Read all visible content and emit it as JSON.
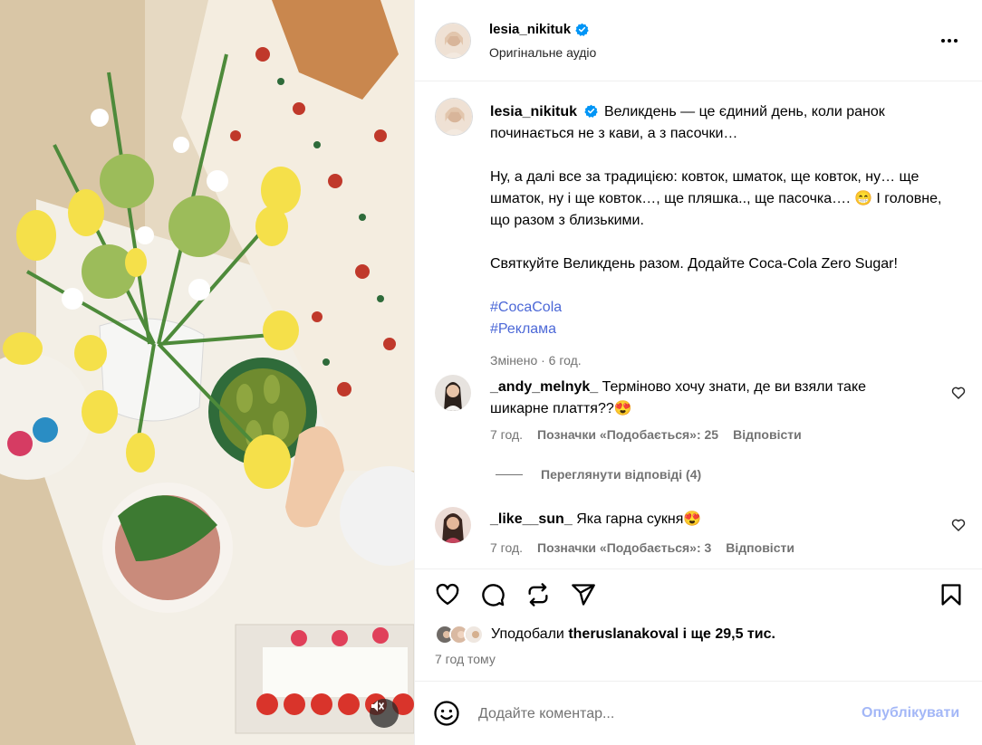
{
  "post": {
    "author": "lesia_nikituk",
    "audio": "Оригінальне аудіо",
    "caption": {
      "line1": "Великдень — це єдиний день, коли ранок починається не з кави, а з пасочки…",
      "para2": "Ну, а далі все за традицією: ковток, шматок, ще ковток, ну… ще шматок, ну і ще ковток…, ще пляшка.., ще пасочка…. 😁 І головне, що разом з близькими.",
      "para3": "Святкуйте Великдень разом. Додайте Coca-Cola Zero Sugar!",
      "hashtags": [
        "#CocaCola",
        "#Реклама"
      ],
      "meta": "Змінено · 6 год."
    }
  },
  "comments": [
    {
      "user": "_andy_melnyk_",
      "text": "Терміново хочу знати, де ви взяли таке шикарне плаття??😍",
      "time": "7 год.",
      "likes": "Позначки «Подобається»: 25",
      "reply": "Відповісти"
    },
    {
      "user": "_like__sun_",
      "text": "Яка гарна сукня😍",
      "time": "7 год.",
      "likes": "Позначки «Подобається»: 3",
      "reply": "Відповісти"
    }
  ],
  "view_replies": "Переглянути відповіді (4)",
  "likes": {
    "prefix": "Уподобали",
    "user": "theruslanakoval",
    "suffix": "і ще 29,5 тис."
  },
  "time_ago": "7 год тому",
  "composer": {
    "placeholder": "Додайте коментар...",
    "post_label": "Опублікувати"
  },
  "colors": {
    "link": "#4c68d7",
    "verified": "#0095f6",
    "secondary_text": "#737373",
    "post_button_disabled": "#a3b7f7"
  },
  "icons": [
    "more-icon",
    "verified-icon",
    "heart-icon",
    "comment-icon",
    "repost-icon",
    "share-icon",
    "bookmark-icon",
    "emoji-icon",
    "mute-icon"
  ]
}
